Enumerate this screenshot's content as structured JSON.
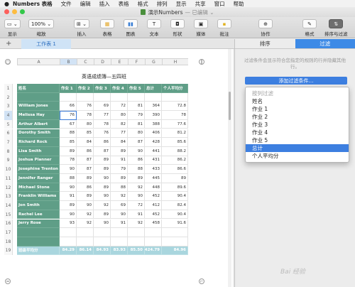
{
  "menubar": {
    "apple": "",
    "items": [
      "Numbers 表格",
      "文件",
      "编辑",
      "插入",
      "表格",
      "格式",
      "排列",
      "显示",
      "共享",
      "窗口",
      "帮助"
    ]
  },
  "window": {
    "title": "演示Numbers",
    "title_suffix": "— 已编辑 ⌄"
  },
  "toolbar": {
    "view_label": "显示",
    "zoom_value": "100% ⌄",
    "zoom_label": "缩放",
    "insert_label": "插入",
    "table_label": "表格",
    "chart_label": "图表",
    "text_label": "文本",
    "shape_label": "形状",
    "media_label": "媒体",
    "comment_label": "批注",
    "collaborate_label": "协作",
    "format_label": "格式",
    "sort_filter_label": "排序与过滤"
  },
  "sheet": {
    "add": "+",
    "tab": "工作表 1"
  },
  "table": {
    "title": "英语成绩簿—五四班",
    "columns": [
      "A",
      "B",
      "C",
      "D",
      "E",
      "F",
      "G",
      "H"
    ],
    "header": [
      "姓名",
      "作业 1",
      "作业 2",
      "作业 3",
      "作业 4",
      "作业 5",
      "总计",
      "个人平均分"
    ],
    "rows": [
      [
        "",
        "",
        "",
        "",
        "",
        "",
        "",
        ""
      ],
      [
        "William Jones",
        "66",
        "76",
        "69",
        "72",
        "81",
        "364",
        "72.8"
      ],
      [
        "Melissa Hay",
        "76",
        "78",
        "77",
        "80",
        "79",
        "390",
        "78"
      ],
      [
        "Arthur Albert",
        "67",
        "80",
        "78",
        "82",
        "81",
        "388",
        "77.6"
      ],
      [
        "Dorothy Smith",
        "88",
        "85",
        "76",
        "77",
        "80",
        "406",
        "81.2"
      ],
      [
        "Richard Rock",
        "85",
        "84",
        "86",
        "84",
        "87",
        "428",
        "85.6"
      ],
      [
        "Lisa Smith",
        "89",
        "86",
        "87",
        "89",
        "90",
        "441",
        "88.2"
      ],
      [
        "Joshua Planner",
        "78",
        "87",
        "89",
        "91",
        "86",
        "431",
        "86.2"
      ],
      [
        "Josephine Trenton",
        "90",
        "87",
        "89",
        "79",
        "88",
        "433",
        "86.6"
      ],
      [
        "Jennifer Ranger",
        "88",
        "89",
        "90",
        "89",
        "89",
        "445",
        "89"
      ],
      [
        "Michael Stone",
        "90",
        "86",
        "89",
        "88",
        "92",
        "448",
        "89.6"
      ],
      [
        "Franklin Williams",
        "91",
        "89",
        "90",
        "92",
        "90",
        "452",
        "90.4"
      ],
      [
        "Jon Smith",
        "89",
        "90",
        "92",
        "69",
        "72",
        "412",
        "82.4"
      ],
      [
        "Rachel Lee",
        "90",
        "92",
        "89",
        "90",
        "91",
        "452",
        "90.4"
      ],
      [
        "Jerry Rose",
        "93",
        "92",
        "90",
        "91",
        "92",
        "458",
        "91.6"
      ],
      [
        "",
        "",
        "",
        "",
        "",
        "",
        "",
        ""
      ],
      [
        "",
        "",
        "",
        "",
        "",
        "",
        "",
        ""
      ]
    ],
    "footer": [
      "班级平均分",
      "84.29",
      "86.14",
      "84.93",
      "83.93",
      "85.50",
      "424.79",
      "84.96"
    ],
    "row_numbers": [
      "1",
      "2",
      "3",
      "4",
      "5",
      "6",
      "7",
      "8",
      "9",
      "10",
      "11",
      "12",
      "13",
      "14",
      "15",
      "16",
      "17",
      "18",
      "19"
    ]
  },
  "panel": {
    "tab_sort": "排序",
    "tab_filter": "过滤",
    "note": "过滤条件会显示符合您指定的规则的行并隐藏其他行。",
    "add_filter": "添加过滤条件…"
  },
  "dropdown": {
    "items": [
      "按列过滤",
      "姓名",
      "作业 1",
      "作业 2",
      "作业 3",
      "作业 4",
      "作业 5",
      "总计",
      "个人平均分"
    ]
  },
  "watermark": "Bai 经验",
  "colors": {
    "header_green": "#5f9e87",
    "footer_teal": "#a9d6de",
    "accent_blue": "#3d7fe0"
  }
}
